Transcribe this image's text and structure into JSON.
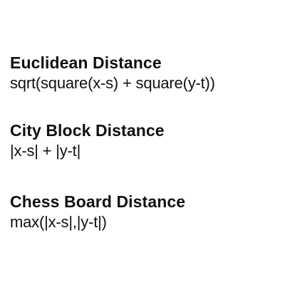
{
  "sections": [
    {
      "heading": "Euclidean Distance",
      "formula": "sqrt(square(x-s) + square(y-t))"
    },
    {
      "heading": "City Block Distance",
      "formula": "|x-s| + |y-t|"
    },
    {
      "heading": "Chess Board Distance",
      "formula": "max(|x-s|,|y-t|)"
    }
  ]
}
